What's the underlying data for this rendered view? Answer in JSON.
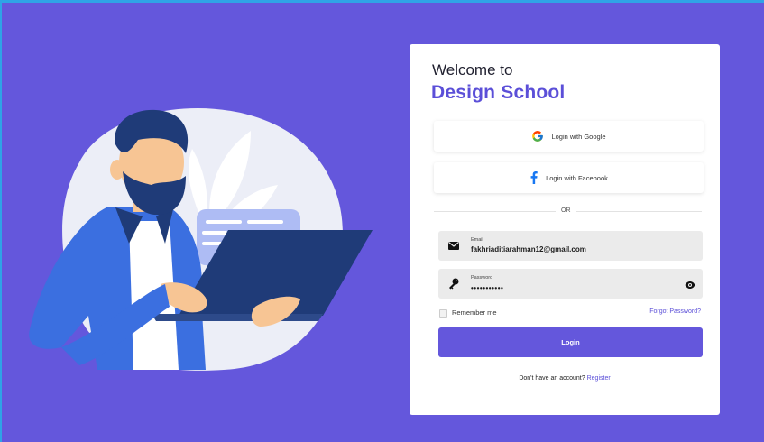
{
  "header": {
    "welcome": "Welcome to",
    "brand": "Design School"
  },
  "social": {
    "google_label": "Login with Google",
    "facebook_label": "Login with Facebook",
    "google_icon": "google-g-icon",
    "facebook_icon": "facebook-f-icon"
  },
  "divider": {
    "text": "OR"
  },
  "email": {
    "label": "Email",
    "value": "fakhriaditiarahman12@gmail.com",
    "icon": "envelope-icon"
  },
  "password": {
    "label": "Password",
    "value": "•••••••••••",
    "icon": "key-icon",
    "toggle_icon": "eye-icon"
  },
  "options": {
    "remember_label": "Remember me",
    "forgot_label": "Forgot Password?"
  },
  "login": {
    "label": "Login"
  },
  "footer": {
    "prompt": "Don't have an account?",
    "register_label": "Register"
  },
  "colors": {
    "background": "#6457dc",
    "brand": "#5b4fd8",
    "illustration_dark": "#1f3b78",
    "illustration_blue": "#3b6fe0"
  }
}
